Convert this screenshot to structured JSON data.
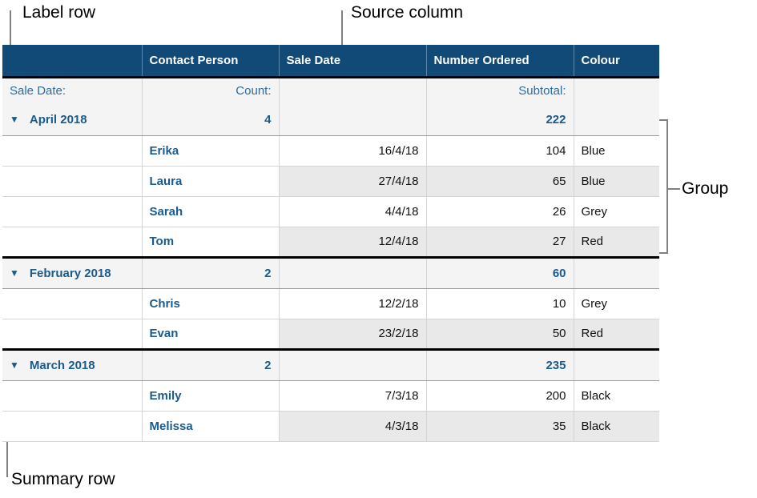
{
  "annotations": {
    "label_row": "Label row",
    "source_column": "Source column",
    "group": "Group",
    "summary_row": "Summary row"
  },
  "colors": {
    "header_bg": "#114a76",
    "header_text": "#ffffff",
    "accent_blue": "#1a5b8e",
    "label_blue": "#2d6ca2",
    "summary_bg": "#f4f4f4",
    "alt_row_bg": "#e9e9e9",
    "row_bg": "#ffffff",
    "group_border": "#000000",
    "grid_line": "#d4d4d4",
    "leader_line": "#808080"
  },
  "table": {
    "columns": [
      {
        "key": "label",
        "label": "",
        "align": "left"
      },
      {
        "key": "contact",
        "label": "Contact Person",
        "align": "left"
      },
      {
        "key": "date",
        "label": "Sale Date",
        "align": "left"
      },
      {
        "key": "number",
        "label": "Number Ordered",
        "align": "left"
      },
      {
        "key": "colour",
        "label": "Colour",
        "align": "left"
      }
    ],
    "label_row": {
      "label": "Sale Date:",
      "contact": "Count:",
      "date": "",
      "number": "Subtotal:",
      "colour": ""
    },
    "disclosure_glyph": "▼",
    "groups": [
      {
        "name": "April 2018",
        "count": "4",
        "subtotal": "222",
        "rows": [
          {
            "contact": "Erika",
            "date": "16/4/18",
            "number": "104",
            "colour": "Blue"
          },
          {
            "contact": "Laura",
            "date": "27/4/18",
            "number": "65",
            "colour": "Blue"
          },
          {
            "contact": "Sarah",
            "date": "4/4/18",
            "number": "26",
            "colour": "Grey"
          },
          {
            "contact": "Tom",
            "date": "12/4/18",
            "number": "27",
            "colour": "Red"
          }
        ]
      },
      {
        "name": "February 2018",
        "count": "2",
        "subtotal": "60",
        "rows": [
          {
            "contact": "Chris",
            "date": "12/2/18",
            "number": "10",
            "colour": "Grey"
          },
          {
            "contact": "Evan",
            "date": "23/2/18",
            "number": "50",
            "colour": "Red"
          }
        ]
      },
      {
        "name": "March 2018",
        "count": "2",
        "subtotal": "235",
        "rows": [
          {
            "contact": "Emily",
            "date": "7/3/18",
            "number": "200",
            "colour": "Black"
          },
          {
            "contact": "Melissa",
            "date": "4/3/18",
            "number": "35",
            "colour": "Black"
          }
        ]
      }
    ]
  }
}
